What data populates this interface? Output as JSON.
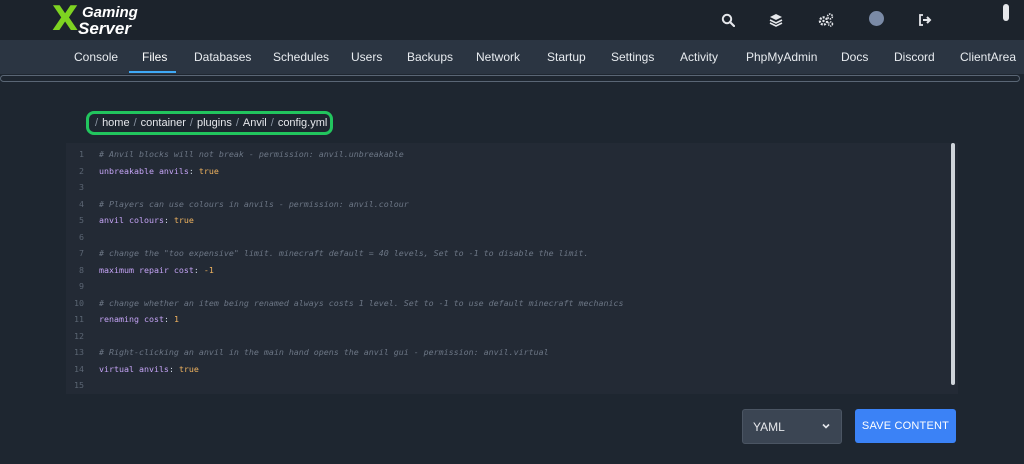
{
  "app": {
    "logo_mark": "X",
    "logo_line1": "Gaming",
    "logo_line2": "Server"
  },
  "topbar_icons": [
    "search-icon",
    "layers-icon",
    "cogs-icon",
    "avatar",
    "sign-out-icon"
  ],
  "nav": {
    "items": [
      "Console",
      "Files",
      "Databases",
      "Schedules",
      "Users",
      "Backups",
      "Network",
      "Startup",
      "Settings",
      "Activity",
      "PhpMyAdmin",
      "Docs",
      "Discord",
      "ClientArea"
    ],
    "active": "Files"
  },
  "breadcrumb": {
    "root": "/",
    "separator": "/",
    "segments": [
      "home",
      "container",
      "plugins",
      "Anvil",
      "config.yml"
    ]
  },
  "editor": {
    "line_numbers": [
      "1",
      "2",
      "3",
      "4",
      "5",
      "6",
      "7",
      "8",
      "9",
      "10",
      "11",
      "12",
      "13",
      "14",
      "15"
    ],
    "lines": [
      {
        "comment": "# Anvil blocks will not break - permission: anvil.unbreakable"
      },
      {
        "key": "unbreakable anvils",
        "value": "true"
      },
      {},
      {
        "comment": "# Players can use colours in anvils - permission: anvil.colour"
      },
      {
        "key": "anvil colours",
        "value": "true"
      },
      {},
      {
        "comment": "# change the \"too expensive\" limit. minecraft default = 40 levels, Set to -1 to disable the limit."
      },
      {
        "key": "maximum repair cost",
        "value": "-1"
      },
      {},
      {
        "comment": "# change whether an item being renamed always costs 1 level. Set to -1 to use default minecraft mechanics"
      },
      {
        "key": "renaming cost",
        "value": "1"
      },
      {},
      {
        "comment": "# Right-clicking an anvil in the main hand opens the anvil gui - permission: anvil.virtual"
      },
      {
        "key": "virtual anvils",
        "value": "true"
      },
      {}
    ]
  },
  "footer": {
    "language": "YAML",
    "save_label": "SAVE CONTENT"
  },
  "colors": {
    "accent": "#3b82f6",
    "highlight": "#22c55e",
    "key": "#c4a3f5",
    "value": "#f0b35f"
  }
}
